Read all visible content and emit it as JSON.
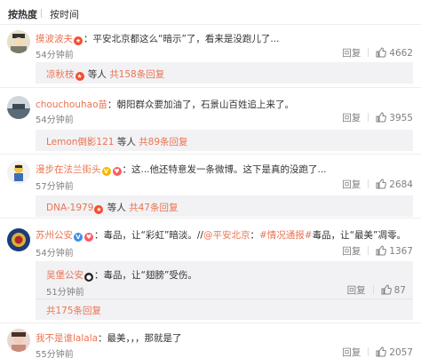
{
  "sort": {
    "hot": "按热度",
    "time": "按时间"
  },
  "comments": [
    {
      "name": "摸波波夫",
      "text": "：平安北京都这么“暗示”了，看来是没跑儿了...",
      "time": "54分钟前",
      "reply": "回复",
      "likes": "4662",
      "sub": {
        "user": "凉秋枝",
        "rest": " 等人 ",
        "count": "共158条回复"
      }
    },
    {
      "name": "chouchouhao苗",
      "text": "：朝阳群众要加油了，石景山百姓追上来了。",
      "time": "54分钟前",
      "reply": "回复",
      "likes": "3955",
      "sub": {
        "user": "Lemon倒影121",
        "rest": " 等人 ",
        "count": "共89条回复"
      }
    },
    {
      "name": "漫步在法兰街头",
      "text": "：这...他还特意发一条微博。这下是真的没跑了...",
      "time": "57分钟前",
      "reply": "回复",
      "likes": "2684",
      "sub": {
        "user": "DNA-1979",
        "rest": " 等人 ",
        "count": "共47条回复"
      }
    },
    {
      "name": "苏州公安",
      "text_a": "：毒品，让“彩虹”暗淡。//",
      "mention": "@平安北京",
      "text_b": "：",
      "topic": "#情况通报#",
      "text_c": "毒品，让“最美”凋零。",
      "time": "54分钟前",
      "reply": "回复",
      "likes": "1367",
      "sub": {
        "name": "吴堡公安",
        "text": "：毒品，让“翅膀”受伤。",
        "time": "51分钟前",
        "reply": "回复",
        "likes": "87",
        "count": "共175条回复"
      }
    },
    {
      "name": "我不是谁lalala",
      "text": "：最美，，，那就是了",
      "time": "55分钟前",
      "reply": "回复",
      "likes": "2057"
    }
  ]
}
